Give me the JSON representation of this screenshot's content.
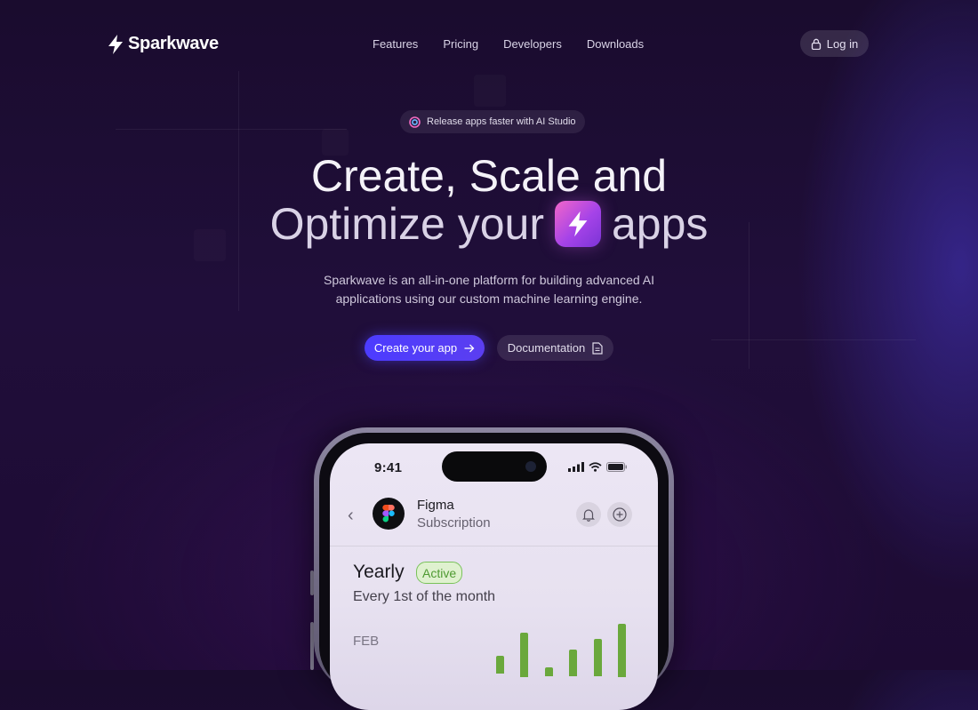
{
  "brand": {
    "name": "Sparkwave"
  },
  "nav": {
    "links": [
      "Features",
      "Pricing",
      "Developers",
      "Downloads"
    ],
    "login_label": "Log in"
  },
  "badge": {
    "text": "Release apps faster with AI Studio"
  },
  "hero": {
    "line1": "Create, Scale and",
    "line2_before": "Optimize your",
    "line2_after": "apps",
    "subtitle_line1": "Sparkwave is an all-in-one platform for building advanced AI",
    "subtitle_line2": "applications using our custom machine learning engine."
  },
  "cta": {
    "primary_label": "Create your app",
    "secondary_label": "Documentation"
  },
  "phone": {
    "status_time": "9:41",
    "app_name": "Figma",
    "app_subtitle": "Subscription",
    "plan_title": "Yearly",
    "plan_status": "Active",
    "plan_schedule": "Every 1st of the month",
    "chart_month": "FEB"
  },
  "colors": {
    "accent": "#4c3cff",
    "active_green": "#6aa83c",
    "app_icon_gradient_start": "#f266c9",
    "app_icon_gradient_end": "#7b34d6"
  }
}
